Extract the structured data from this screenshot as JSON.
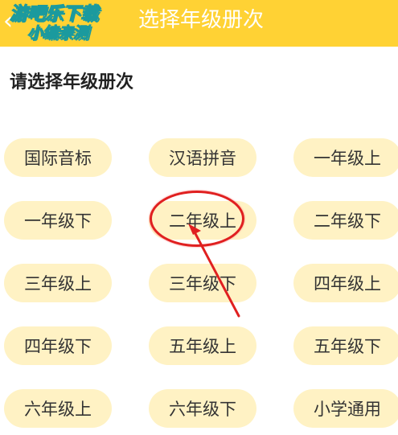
{
  "header": {
    "title": "选择年级册次",
    "watermark_line1": "游吧乐下载",
    "watermark_line2": "小编亲测"
  },
  "section_title": "请选择年级册次",
  "grades": [
    "国际音标",
    "汉语拼音",
    "一年级上",
    "一年级下",
    "二年级上",
    "二年级下",
    "三年级上",
    "三年级下",
    "四年级上",
    "四年级下",
    "五年级上",
    "五年级下",
    "六年级上",
    "六年级下",
    "小学通用"
  ],
  "highlighted": "二年级上",
  "colors": {
    "header_bg": "#ffd234",
    "button_bg": "#fff2c4",
    "annotation_red": "#e02020"
  }
}
